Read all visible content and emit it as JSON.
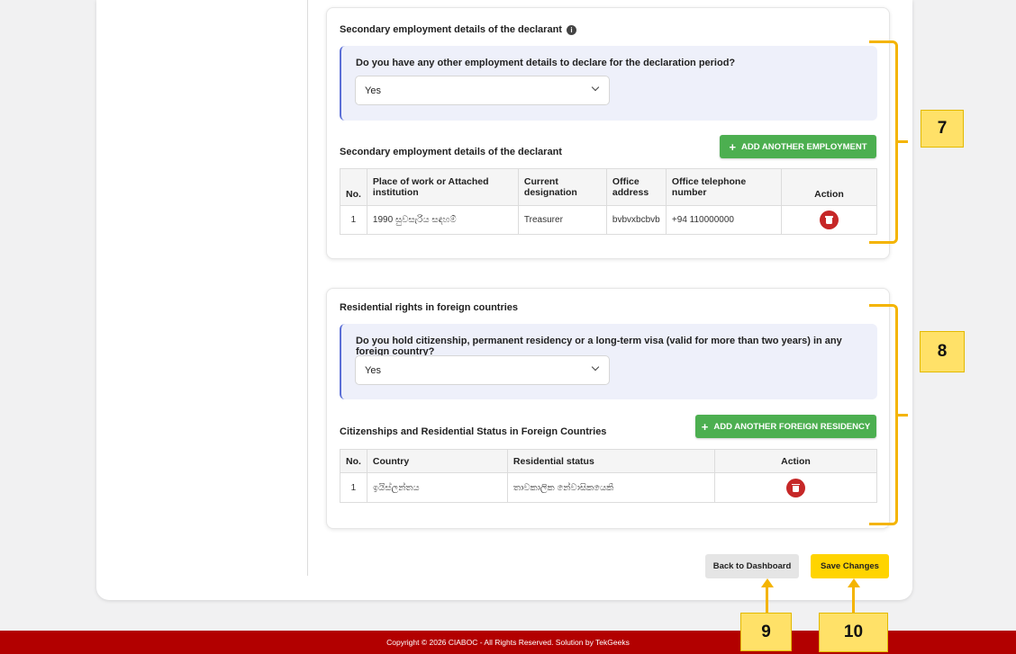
{
  "employment": {
    "title": "Secondary employment details of the declarant",
    "question": "Do you have any other employment details to declare for the declaration period?",
    "answer": "Yes",
    "table_title": "Secondary employment details of the declarant",
    "add_button": "ADD ANOTHER EMPLOYMENT",
    "columns": [
      "No.",
      "Place of work or Attached institution",
      "Current designation",
      "Office address",
      "Office telephone number",
      "Action"
    ],
    "rows": [
      {
        "no": "1",
        "place": "1990 සුවසැරිය සඳහම්",
        "designation": "Treasurer",
        "address": "bvbvxbcbvb",
        "phone": "+94 110000000"
      }
    ]
  },
  "residency": {
    "title": "Residential rights in foreign countries",
    "question": "Do you hold citizenship, permanent residency or a long-term visa (valid for more than two years) in any foreign country?",
    "answer": "Yes",
    "table_title": "Citizenships and Residential Status in Foreign Countries",
    "add_button": "ADD ANOTHER FOREIGN RESIDENCY",
    "columns": [
      "No.",
      "Country",
      "Residential status",
      "Action"
    ],
    "rows": [
      {
        "no": "1",
        "country": "ඉයිස්ලන්තය",
        "status": "තාවකාලික නේවාසිකයෙකි"
      }
    ]
  },
  "actions": {
    "back": "Back to Dashboard",
    "save": "Save Changes"
  },
  "footer": {
    "text": "Copyright © 2026 CIABOC - All Rights Reserved. Solution by TekGeeks"
  },
  "callouts": {
    "c7": "7",
    "c8": "8",
    "c9": "9",
    "c10": "10"
  },
  "colors": {
    "accent_green": "#4caf50",
    "save_yellow": "#ffd400",
    "footer_red": "#b20000",
    "delete_red": "#c62828",
    "annotation_amber": "#f4b400"
  },
  "icons": [
    "info-icon",
    "plus-icon",
    "chevron-down-icon",
    "trash-icon",
    "arrow-up-icon"
  ]
}
